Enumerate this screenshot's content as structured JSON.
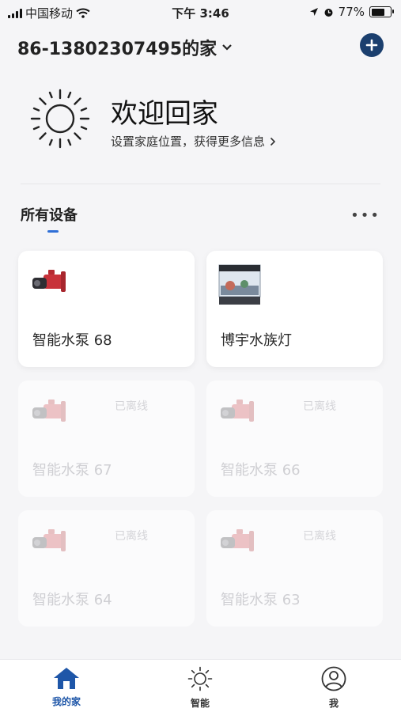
{
  "status_bar": {
    "carrier": "中国移动",
    "time": "下午 3:46",
    "battery": "77%",
    "battery_level": 0.77
  },
  "header": {
    "home_name": "86-13802307495的家",
    "add_icon": "plus-icon"
  },
  "welcome": {
    "title": "欢迎回家",
    "subtitle": "设置家庭位置，获得更多信息",
    "icon": "sun-icon"
  },
  "section": {
    "title": "所有设备",
    "more": "•••"
  },
  "devices": [
    {
      "name": "智能水泵 68",
      "status": "",
      "icon": "pump-icon"
    },
    {
      "name": "博宇水族灯",
      "status": "",
      "icon": "aquarium-icon"
    },
    {
      "name": "智能水泵 67",
      "status": "已离线",
      "icon": "pump-icon"
    },
    {
      "name": "智能水泵 66",
      "status": "已离线",
      "icon": "pump-icon"
    },
    {
      "name": "智能水泵 64",
      "status": "已离线",
      "icon": "pump-icon"
    },
    {
      "name": "智能水泵 63",
      "status": "已离线",
      "icon": "pump-icon"
    }
  ],
  "tabbar": {
    "tabs": [
      {
        "label": "我的家",
        "icon": "home-icon",
        "active": true
      },
      {
        "label": "智能",
        "icon": "sun-icon",
        "active": false
      },
      {
        "label": "我",
        "icon": "user-icon",
        "active": false
      }
    ]
  },
  "colors": {
    "accent": "#1e56a8",
    "add_button": "#1b3f6e",
    "section_underline": "#2f6fd6"
  }
}
